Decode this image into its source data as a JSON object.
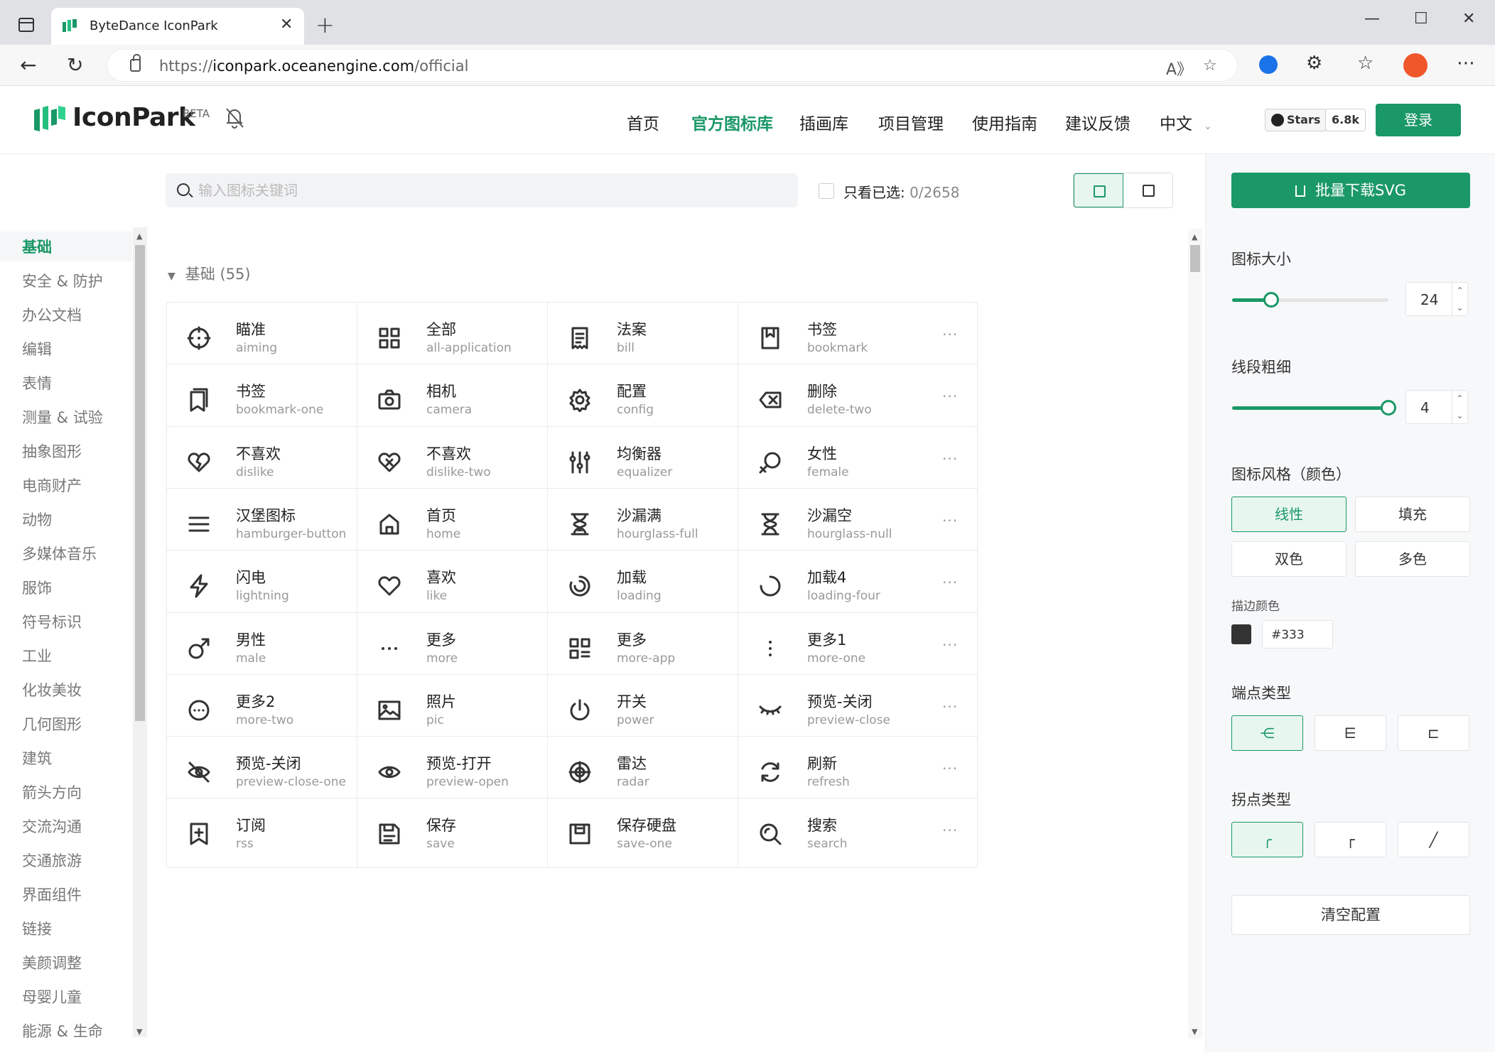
{
  "browser": {
    "tab_title": "ByteDance IconPark",
    "url_scheme": "https://",
    "url_host": "iconpark.oceanengine.com",
    "url_path": "/official"
  },
  "header": {
    "brand": "IconPark",
    "beta": "BETA",
    "nav": [
      "首页",
      "官方图标库",
      "插画库",
      "项目管理",
      "使用指南",
      "建议反馈",
      "中文"
    ],
    "active_nav": "官方图标库",
    "github_label": "Stars",
    "github_count": "6.8k",
    "login": "登录"
  },
  "toolbar": {
    "search_placeholder": "输入图标关键词",
    "only_selected_label": "只看已选: ",
    "only_selected_count": "0/2658"
  },
  "categories": [
    "基础",
    "安全 & 防护",
    "办公文档",
    "编辑",
    "表情",
    "测量 & 试验",
    "抽象图形",
    "电商财产",
    "动物",
    "多媒体音乐",
    "服饰",
    "符号标识",
    "工业",
    "化妆美妆",
    "几何图形",
    "建筑",
    "箭头方向",
    "交流沟通",
    "交通旅游",
    "界面组件",
    "链接",
    "美颜调整",
    "母婴儿童",
    "能源 & 生命"
  ],
  "active_category": "基础",
  "section": {
    "title": "基础 (55)"
  },
  "icons": [
    {
      "zh": "瞄准",
      "en": "aiming",
      "icon": "aiming-icon"
    },
    {
      "zh": "全部",
      "en": "all-application",
      "icon": "all-application-icon"
    },
    {
      "zh": "法案",
      "en": "bill",
      "icon": "bill-icon"
    },
    {
      "zh": "书签",
      "en": "bookmark",
      "icon": "bookmark-icon"
    },
    {
      "zh": "书签",
      "en": "bookmark-one",
      "icon": "bookmark-one-icon"
    },
    {
      "zh": "相机",
      "en": "camera",
      "icon": "camera-icon"
    },
    {
      "zh": "配置",
      "en": "config",
      "icon": "config-icon"
    },
    {
      "zh": "删除",
      "en": "delete-two",
      "icon": "delete-two-icon"
    },
    {
      "zh": "不喜欢",
      "en": "dislike",
      "icon": "dislike-icon"
    },
    {
      "zh": "不喜欢",
      "en": "dislike-two",
      "icon": "dislike-two-icon"
    },
    {
      "zh": "均衡器",
      "en": "equalizer",
      "icon": "equalizer-icon"
    },
    {
      "zh": "女性",
      "en": "female",
      "icon": "female-icon"
    },
    {
      "zh": "汉堡图标",
      "en": "hamburger-button",
      "icon": "hamburger-button-icon"
    },
    {
      "zh": "首页",
      "en": "home",
      "icon": "home-icon"
    },
    {
      "zh": "沙漏满",
      "en": "hourglass-full",
      "icon": "hourglass-full-icon"
    },
    {
      "zh": "沙漏空",
      "en": "hourglass-null",
      "icon": "hourglass-null-icon"
    },
    {
      "zh": "闪电",
      "en": "lightning",
      "icon": "lightning-icon"
    },
    {
      "zh": "喜欢",
      "en": "like",
      "icon": "like-icon"
    },
    {
      "zh": "加载",
      "en": "loading",
      "icon": "loading-icon"
    },
    {
      "zh": "加载4",
      "en": "loading-four",
      "icon": "loading-four-icon"
    },
    {
      "zh": "男性",
      "en": "male",
      "icon": "male-icon"
    },
    {
      "zh": "更多",
      "en": "more",
      "icon": "more-icon"
    },
    {
      "zh": "更多",
      "en": "more-app",
      "icon": "more-app-icon"
    },
    {
      "zh": "更多1",
      "en": "more-one",
      "icon": "more-one-icon"
    },
    {
      "zh": "更多2",
      "en": "more-two",
      "icon": "more-two-icon"
    },
    {
      "zh": "照片",
      "en": "pic",
      "icon": "pic-icon"
    },
    {
      "zh": "开关",
      "en": "power",
      "icon": "power-icon"
    },
    {
      "zh": "预览-关闭",
      "en": "preview-close",
      "icon": "preview-close-icon"
    },
    {
      "zh": "预览-关闭",
      "en": "preview-close-one",
      "icon": "preview-close-one-icon"
    },
    {
      "zh": "预览-打开",
      "en": "preview-open",
      "icon": "preview-open-icon"
    },
    {
      "zh": "雷达",
      "en": "radar",
      "icon": "radar-icon"
    },
    {
      "zh": "刷新",
      "en": "refresh",
      "icon": "refresh-icon"
    },
    {
      "zh": "订阅",
      "en": "rss",
      "icon": "rss-icon"
    },
    {
      "zh": "保存",
      "en": "save",
      "icon": "save-icon"
    },
    {
      "zh": "保存硬盘",
      "en": "save-one",
      "icon": "save-one-icon"
    },
    {
      "zh": "搜索",
      "en": "search",
      "icon": "search-icon"
    }
  ],
  "panel": {
    "download": "批量下载SVG",
    "size_label": "图标大小",
    "size_value": "24",
    "size_level": 0.25,
    "stroke_label": "线段粗细",
    "stroke_value": "4",
    "stroke_level": 1.0,
    "style_label": "图标风格（颜色）",
    "styles": [
      "线性",
      "填充",
      "双色",
      "多色"
    ],
    "active_style": "线性",
    "stroke_color_label": "描边颜色",
    "stroke_color": "#333",
    "cap_label": "端点类型",
    "join_label": "拐点类型",
    "clear": "清空配置"
  },
  "colors": {
    "accent": "#1a9867",
    "text": "#333333"
  }
}
